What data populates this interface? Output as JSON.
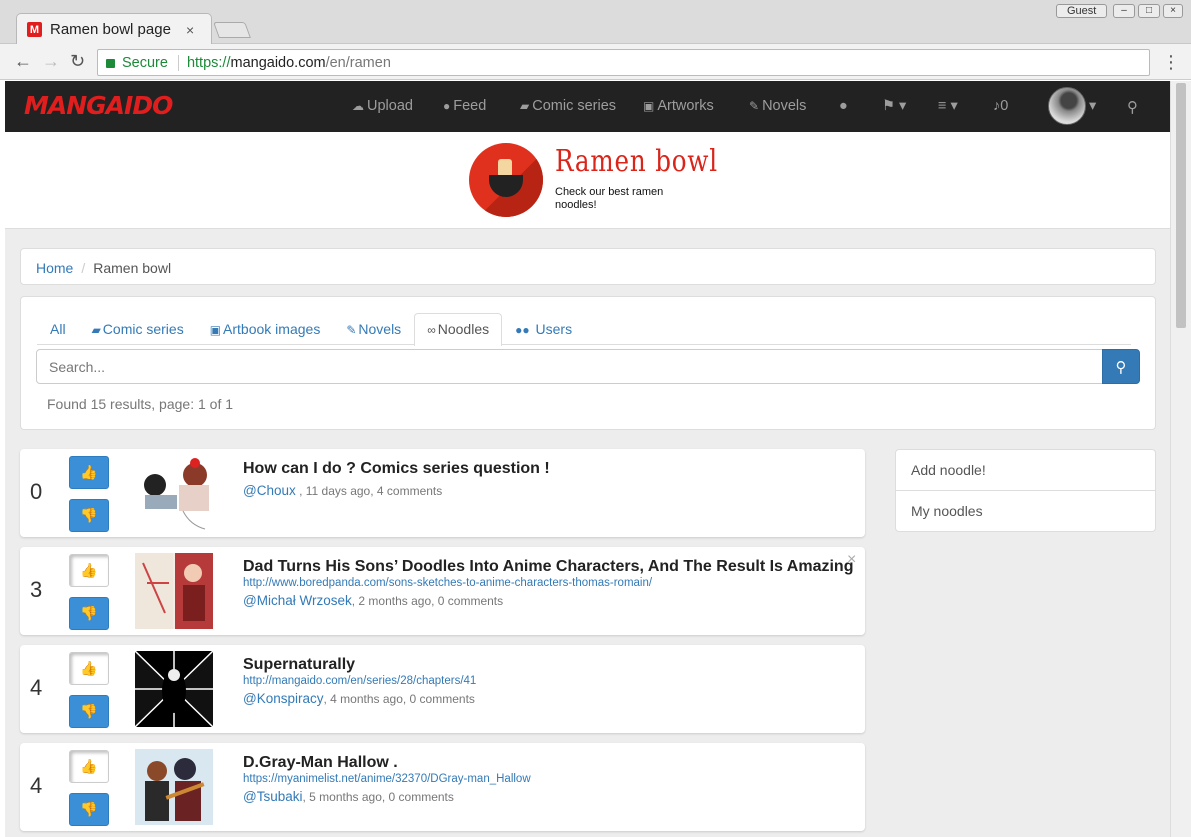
{
  "browser": {
    "tab_title": "Ramen bowl page |",
    "tab_favicon": "M",
    "tab_close": "×",
    "guest_label": "Guest",
    "secure_label": "Secure",
    "url_proto": "https://",
    "url_host": "mangaido.com",
    "url_path": "/en/ramen"
  },
  "navbar": {
    "logo": "MANGAIDO",
    "items": [
      {
        "icon": "upload-icon",
        "label": "Upload"
      },
      {
        "icon": "comments-icon",
        "label": "Feed"
      },
      {
        "icon": "book-icon",
        "label": "Comic series"
      },
      {
        "icon": "image-icon",
        "label": "Artworks"
      },
      {
        "icon": "edit-icon",
        "label": "Novels"
      }
    ],
    "notifications_count": "0"
  },
  "banner": {
    "title": "Ramen bowl",
    "subtitle": "Check our best ramen noodles!"
  },
  "breadcrumb": {
    "home": "Home",
    "separator": "/",
    "current": "Ramen bowl"
  },
  "search": {
    "tabs": [
      {
        "label": "All",
        "icon": ""
      },
      {
        "label": "Comic series",
        "icon": "book-icon"
      },
      {
        "label": "Artbook images",
        "icon": "image-icon"
      },
      {
        "label": "Novels",
        "icon": "edit-icon"
      },
      {
        "label": "Noodles",
        "icon": "link-icon"
      },
      {
        "label": "Users",
        "icon": "users-icon"
      }
    ],
    "active_tab": "Noodles",
    "placeholder": "Search...",
    "results_info": "Found 15 results, page: 1 of 1"
  },
  "noodles": [
    {
      "score": "0",
      "title": "How can I do ? Comics series question !",
      "link": "",
      "user": "@Choux",
      "meta": " , 11 days ago, 4 comments",
      "voted": "none"
    },
    {
      "score": "3",
      "title": "Dad Turns His Sons’ Doodles Into Anime Characters, And The Result Is Amazing",
      "link": "http://www.boredpanda.com/sons-sketches-to-anime-characters-thomas-romain/",
      "user": "@Michał Wrzosek",
      "meta": ", 2 months ago, 0 comments",
      "voted": "up"
    },
    {
      "score": "4",
      "title": "Supernaturally",
      "link": "http://mangaido.com/en/series/28/chapters/41",
      "user": "@Konspiracy",
      "meta": ", 4 months ago, 0 comments",
      "voted": "up"
    },
    {
      "score": "4",
      "title": "D.Gray-Man Hallow .",
      "link": "https://myanimelist.net/anime/32370/DGray-man_Hallow",
      "user": "@Tsubaki",
      "meta": ", 5 months ago, 0 comments",
      "voted": "up"
    }
  ],
  "sidebar": {
    "items": [
      "Add noodle!",
      "My noodles"
    ]
  }
}
